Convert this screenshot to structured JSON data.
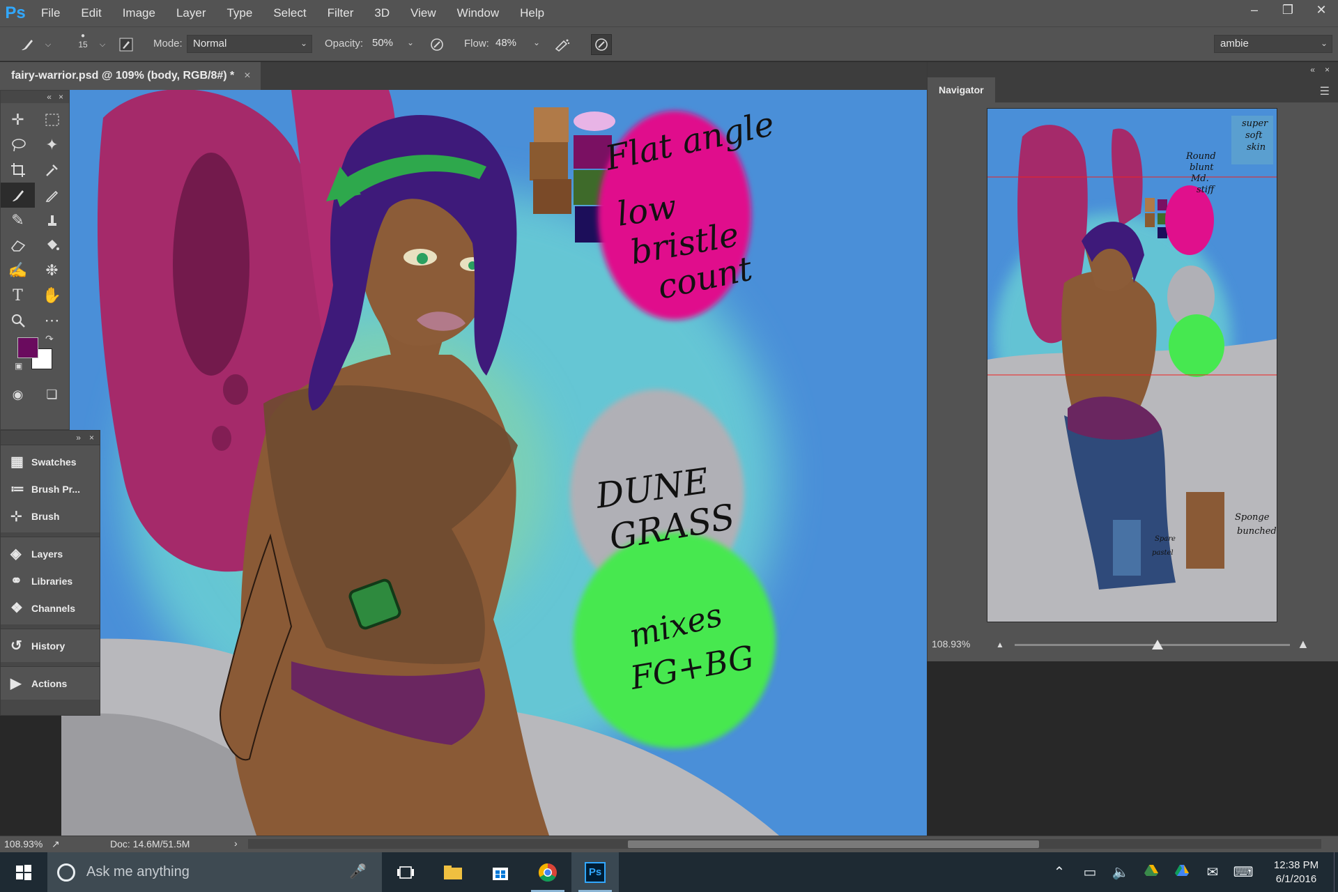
{
  "app": {
    "logo": "Ps",
    "accent": "#31a8ff"
  },
  "menu": [
    "File",
    "Edit",
    "Image",
    "Layer",
    "Type",
    "Select",
    "Filter",
    "3D",
    "View",
    "Window",
    "Help"
  ],
  "window_controls": {
    "minimize": "minimize-icon",
    "restore": "restore-icon",
    "close": "close-icon"
  },
  "options": {
    "brush_size": "15",
    "mode_label": "Mode:",
    "mode_value": "Normal",
    "opacity_label": "Opacity:",
    "opacity_value": "50%",
    "flow_label": "Flow:",
    "flow_value": "48%",
    "workspace": "ambie"
  },
  "document": {
    "tab_title": "fairy-warrior.psd @ 109% (body, RGB/8#) *",
    "colors": {
      "foreground": "#6a0b5e",
      "background": "#ffffff"
    }
  },
  "canvas_annotations": {
    "flat_angle": "Flat angle",
    "low": "low",
    "bristle": "bristle",
    "count": "count",
    "dune": "DUNE",
    "grass": "GRASS",
    "mixes": "mixes",
    "fg_bg": "FG+BG"
  },
  "nav_annotations": {
    "super": "super",
    "soft": "soft",
    "skin": "skin",
    "round": "Round",
    "blunt": "blunt",
    "md": "Md.",
    "stiff": "stiff",
    "sponge": "Sponge",
    "bunched": "bunched",
    "spare": "Spare",
    "pastel": "pastel"
  },
  "dock": {
    "group1": [
      {
        "name": "swatches",
        "label": "Swatches",
        "icon": "grid-icon"
      },
      {
        "name": "brush-presets",
        "label": "Brush Pr...",
        "icon": "brush-presets-icon"
      },
      {
        "name": "brush",
        "label": "Brush",
        "icon": "brush-icon"
      }
    ],
    "group2": [
      {
        "name": "layers",
        "label": "Layers",
        "icon": "layers-icon"
      },
      {
        "name": "libraries",
        "label": "Libraries",
        "icon": "libraries-icon"
      },
      {
        "name": "channels",
        "label": "Channels",
        "icon": "channels-icon"
      }
    ],
    "history": "History",
    "actions": "Actions"
  },
  "navigator": {
    "tab": "Navigator",
    "zoom": "108.93%",
    "zoom_slider_fraction": 0.52
  },
  "status": {
    "zoom": "108.93%",
    "doc": "Doc: 14.6M/51.5M",
    "arrow": "›"
  },
  "taskbar": {
    "search_placeholder": "Ask me anything",
    "time": "12:38 PM",
    "date": "6/1/2016"
  }
}
